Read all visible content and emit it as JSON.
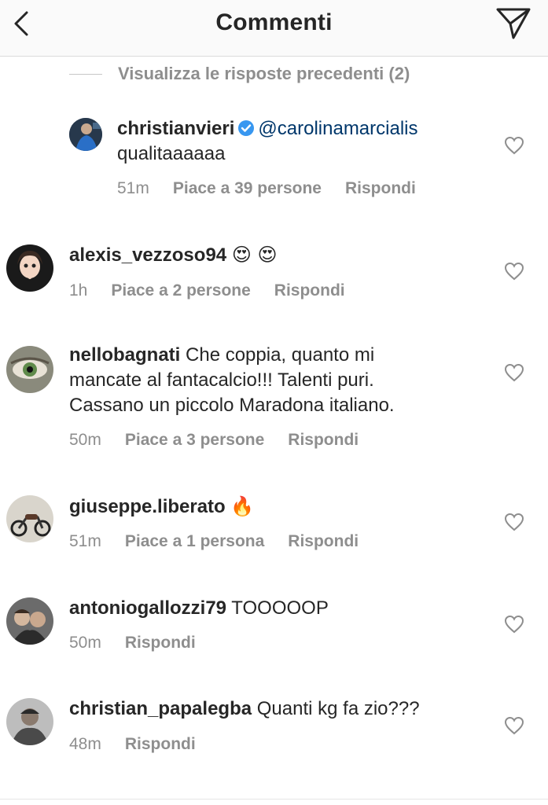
{
  "header": {
    "title": "Commenti"
  },
  "previous_replies": "Visualizza le risposte precedenti (2)",
  "comments": [
    {
      "username": "christianvieri",
      "verified": true,
      "mention": "@carolinamarcialis",
      "text": "qualitaaaaaa",
      "time": "51m",
      "likes": "Piace a 39 persone",
      "reply": "Rispondi"
    },
    {
      "username": "alexis_vezzoso94",
      "emoji": "😍 😍",
      "time": "1h",
      "likes": "Piace a 2 persone",
      "reply": "Rispondi"
    },
    {
      "username": "nellobagnati",
      "text_line1": "Che coppia, quanto mi",
      "text_line2": "mancate al fantacalcio!!! Talenti puri.",
      "text_line3": "Cassano un piccolo Maradona italiano.",
      "time": "50m",
      "likes": "Piace a 3 persone",
      "reply": "Rispondi"
    },
    {
      "username": "giuseppe.liberato",
      "emoji": "🔥",
      "time": "51m",
      "likes": "Piace a 1 persona",
      "reply": "Rispondi"
    },
    {
      "username": "antoniogallozzi79",
      "text": "TOOOOOP",
      "time": "50m",
      "reply": "Rispondi"
    },
    {
      "username": "christian_papalegba",
      "text": "Quanti kg fa zio???",
      "time": "48m",
      "reply": "Rispondi"
    }
  ],
  "colors": {
    "text": "#262626",
    "secondary": "#8e8e8e",
    "mention": "#00376b",
    "verified": "#3897f0"
  }
}
